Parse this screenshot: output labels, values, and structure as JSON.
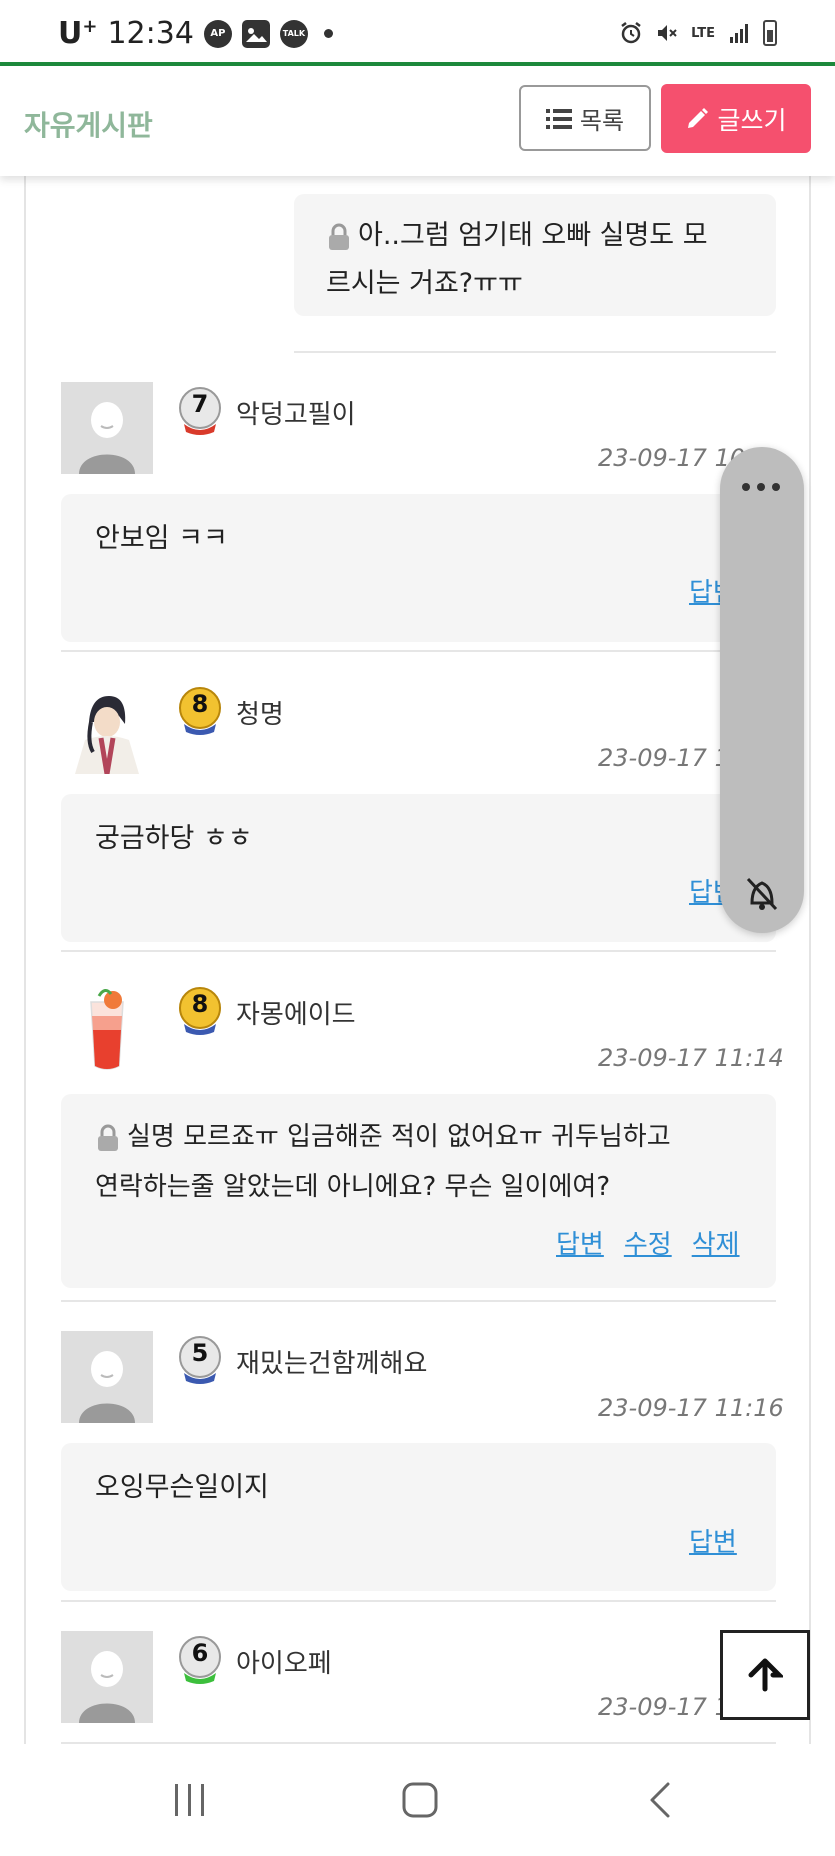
{
  "status_bar": {
    "carrier": "U",
    "carrier_sup": "+",
    "time": "12:34",
    "icons_left": [
      "ap-icon",
      "gallery-icon",
      "talk-icon",
      "dot"
    ],
    "ap_label": "AP",
    "talk_label": "TALK",
    "network": "LTE",
    "icons_right": [
      "alarm-icon",
      "mute-icon",
      "lte-icon",
      "signal-icon",
      "battery-icon"
    ]
  },
  "header": {
    "title": "자유게시판",
    "list_button": "목록",
    "write_button": "글쓰기",
    "accent": "#f5506e",
    "title_color": "#8fb79a"
  },
  "comments": [
    {
      "type": "reply",
      "locked": true,
      "text_line1": "아..그럼 엄기태 오빠 실명도 모",
      "text_line2": "르시는 거죠?ㅠㅠ"
    },
    {
      "level": "7",
      "level_color": "#d93a2b",
      "name": "악덩고필이",
      "avatar": "default",
      "time": "23-09-17 10:",
      "text": "안보임 ㅋㅋ",
      "actions": [
        "답변"
      ]
    },
    {
      "level": "8",
      "level_color": "#3b59b0",
      "name": "청명",
      "avatar": "character",
      "time": "23-09-17 1",
      "text": "궁금하당 ㅎㅎ",
      "actions": [
        "답변"
      ]
    },
    {
      "level": "8",
      "level_color": "#3b59b0",
      "name": "자몽에이드",
      "avatar": "drink",
      "time": "23-09-17 11:14",
      "locked": true,
      "text_line1": "실명 모르죠ㅠ 입금해준 적이 없어요ㅠ 귀두님하고",
      "text_line2": "연락하는줄 알았는데 아니에요? 무슨 일이에여?",
      "actions": [
        "답변",
        "수정",
        "삭제"
      ]
    },
    {
      "level": "5",
      "level_color": "#3b59b0",
      "name": "재밌는건함께해요",
      "avatar": "default",
      "time": "23-09-17 11:16",
      "text": "오잉무슨일이지",
      "actions": [
        "답변"
      ]
    },
    {
      "level": "6",
      "level_color": "#3cbf3c",
      "name": "아이오페",
      "avatar": "default",
      "time": "23-09-17 11:22"
    }
  ],
  "floating_panel": {
    "icons": [
      "more-icon",
      "mute-bell-icon"
    ]
  },
  "nav_bar": {
    "icons": [
      "recent-apps-icon",
      "home-icon",
      "back-icon"
    ]
  }
}
